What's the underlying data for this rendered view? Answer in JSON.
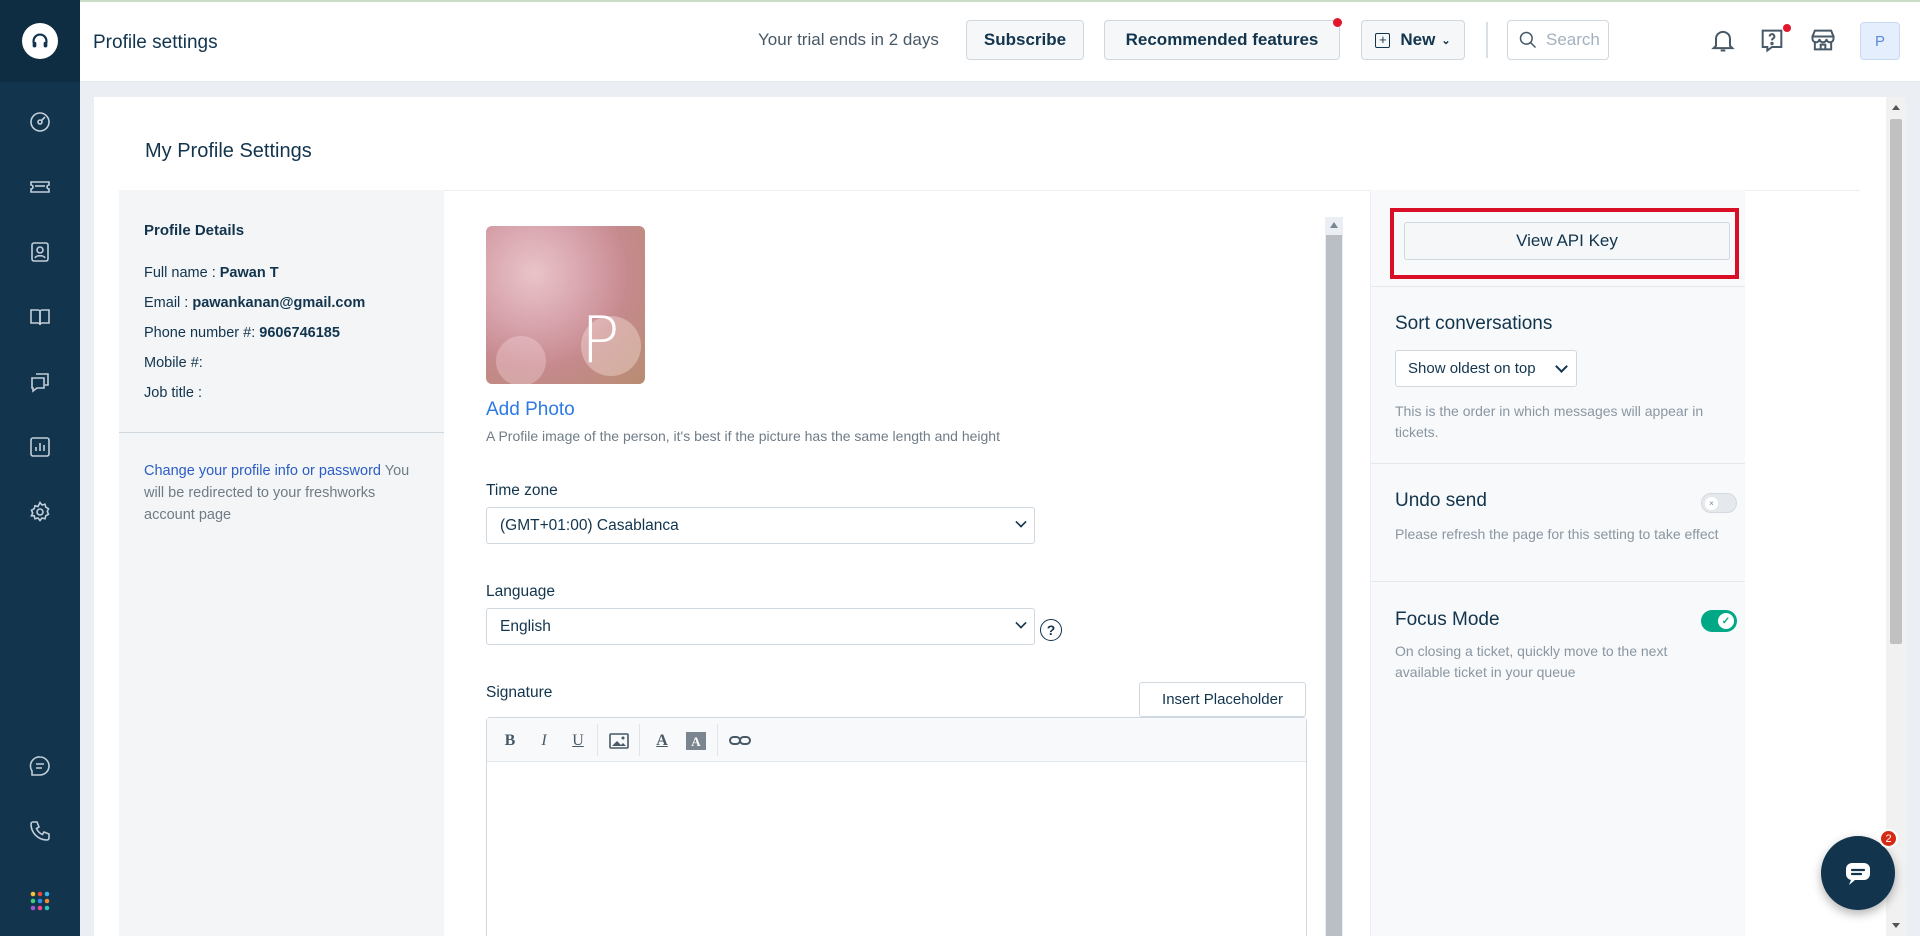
{
  "header": {
    "title": "Profile settings",
    "trial_text": "Your trial ends in 2 days",
    "subscribe_label": "Subscribe",
    "recommended_label": "Recommended features",
    "new_label": "New",
    "search_placeholder": "Search",
    "avatar_initial": "P"
  },
  "page": {
    "section_title": "My Profile Settings"
  },
  "profile_details": {
    "title": "Profile Details",
    "rows": [
      {
        "label": "Full name : ",
        "value": "Pawan T"
      },
      {
        "label": "Email : ",
        "value": "pawankanan@gmail.com"
      },
      {
        "label": "Phone number #: ",
        "value": "9606746185"
      },
      {
        "label": "Mobile #:",
        "value": ""
      },
      {
        "label": "Job title :",
        "value": ""
      }
    ],
    "change_link": "Change your profile info or password",
    "change_note": " You will be redirected to your freshworks account page"
  },
  "form": {
    "photo_initial": "P",
    "add_photo": "Add Photo",
    "photo_help": "A Profile image of the person, it's best if the picture has the same length and height",
    "timezone_label": "Time zone",
    "timezone_value": "(GMT+01:00) Casablanca",
    "language_label": "Language",
    "language_value": "English",
    "signature_label": "Signature",
    "insert_placeholder": "Insert Placeholder"
  },
  "right_panel": {
    "api_key_label": "View API Key",
    "sort_title": "Sort conversations",
    "sort_value": "Show oldest on top",
    "sort_help": "This is the order in which messages will appear in tickets.",
    "undo_title": "Undo send",
    "undo_help": "Please refresh the page for this setting to take effect",
    "undo_enabled": false,
    "focus_title": "Focus Mode",
    "focus_help": "On closing a ticket, quickly move to the next available ticket in your queue",
    "focus_enabled": true
  },
  "chat_widget": {
    "badge_count": "2"
  },
  "colors": {
    "sidebar": "#12344d",
    "accent_link": "#2c7be5",
    "highlight_frame": "#d90f28",
    "toggle_on": "#00a886"
  }
}
